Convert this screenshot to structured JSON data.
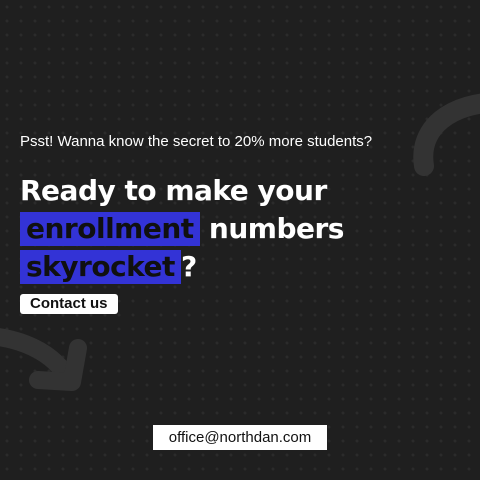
{
  "teaser": "Psst! Wanna know the secret to 20% more students?",
  "headline": {
    "line1": "Ready to make your",
    "highlight1": "enrollment",
    "line2_rest": "numbers",
    "highlight2": "skyrocket",
    "punctuation": "?"
  },
  "cta": {
    "label": "Contact us"
  },
  "contact": {
    "email": "office@northdan.com"
  },
  "colors": {
    "background": "#1f1f1f",
    "highlight": "#3333d6",
    "text": "#ffffff"
  },
  "icons": [
    "curved-arrow-top-icon",
    "curved-arrow-bottom-icon"
  ]
}
